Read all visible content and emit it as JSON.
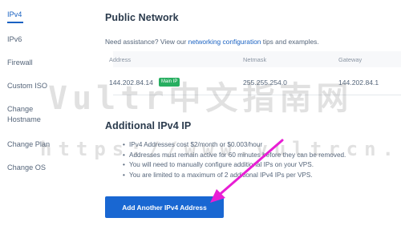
{
  "sidebar": {
    "items": [
      {
        "label": "IPv4",
        "active": true
      },
      {
        "label": "IPv6"
      },
      {
        "label": "Firewall"
      },
      {
        "label": "Custom ISO"
      },
      {
        "label": "Change Hostname"
      },
      {
        "label": "Change Plan"
      },
      {
        "label": "Change OS"
      }
    ]
  },
  "public_network": {
    "title": "Public Network",
    "assist_prefix": "Need assistance? View our ",
    "assist_link": "networking configuration",
    "assist_suffix": " tips and examples.",
    "columns": [
      "Address",
      "Netmask",
      "Gateway"
    ],
    "row": {
      "address": "144.202.84.14",
      "badge": "Main IP",
      "netmask": "255.255.254.0",
      "gateway": "144.202.84.1"
    }
  },
  "additional_ipv4": {
    "title": "Additional IPv4 IP",
    "bullets": [
      "IPv4 Addresses cost $2/month or $0.003/hour",
      "Addresses must remain active for 60 minutes before they can be removed.",
      "You will need to manually configure additional IPs on your VPS.",
      "You are limited to a maximum of 2 additional IPv4 IPs per VPS."
    ],
    "button_label": "Add Another IPv4 Address"
  },
  "watermark": {
    "line1": "Vultr中文指南网",
    "line2": "https://www.vultrcn.com"
  },
  "colors": {
    "accent": "#1a62c2",
    "badge": "#27ae60",
    "arrow": "#e81ed4"
  }
}
